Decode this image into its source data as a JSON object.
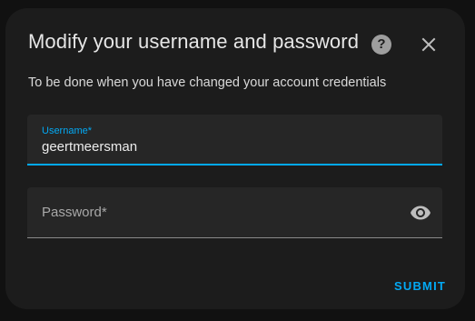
{
  "dialog": {
    "title": "Modify your username and password",
    "help_icon": "question-circle-icon",
    "close_icon": "close-icon",
    "subtitle": "To be done when you have changed your account credentials"
  },
  "username_field": {
    "label": "Username*",
    "value": "geertmeersman"
  },
  "password_field": {
    "label": "Password*",
    "value": "",
    "toggle_icon": "eye-icon"
  },
  "actions": {
    "submit_label": "SUBMIT"
  },
  "colors": {
    "accent": "#03a9f4",
    "dialog_bg": "#1c1c1c",
    "field_bg": "#262626",
    "page_bg": "#111111"
  }
}
